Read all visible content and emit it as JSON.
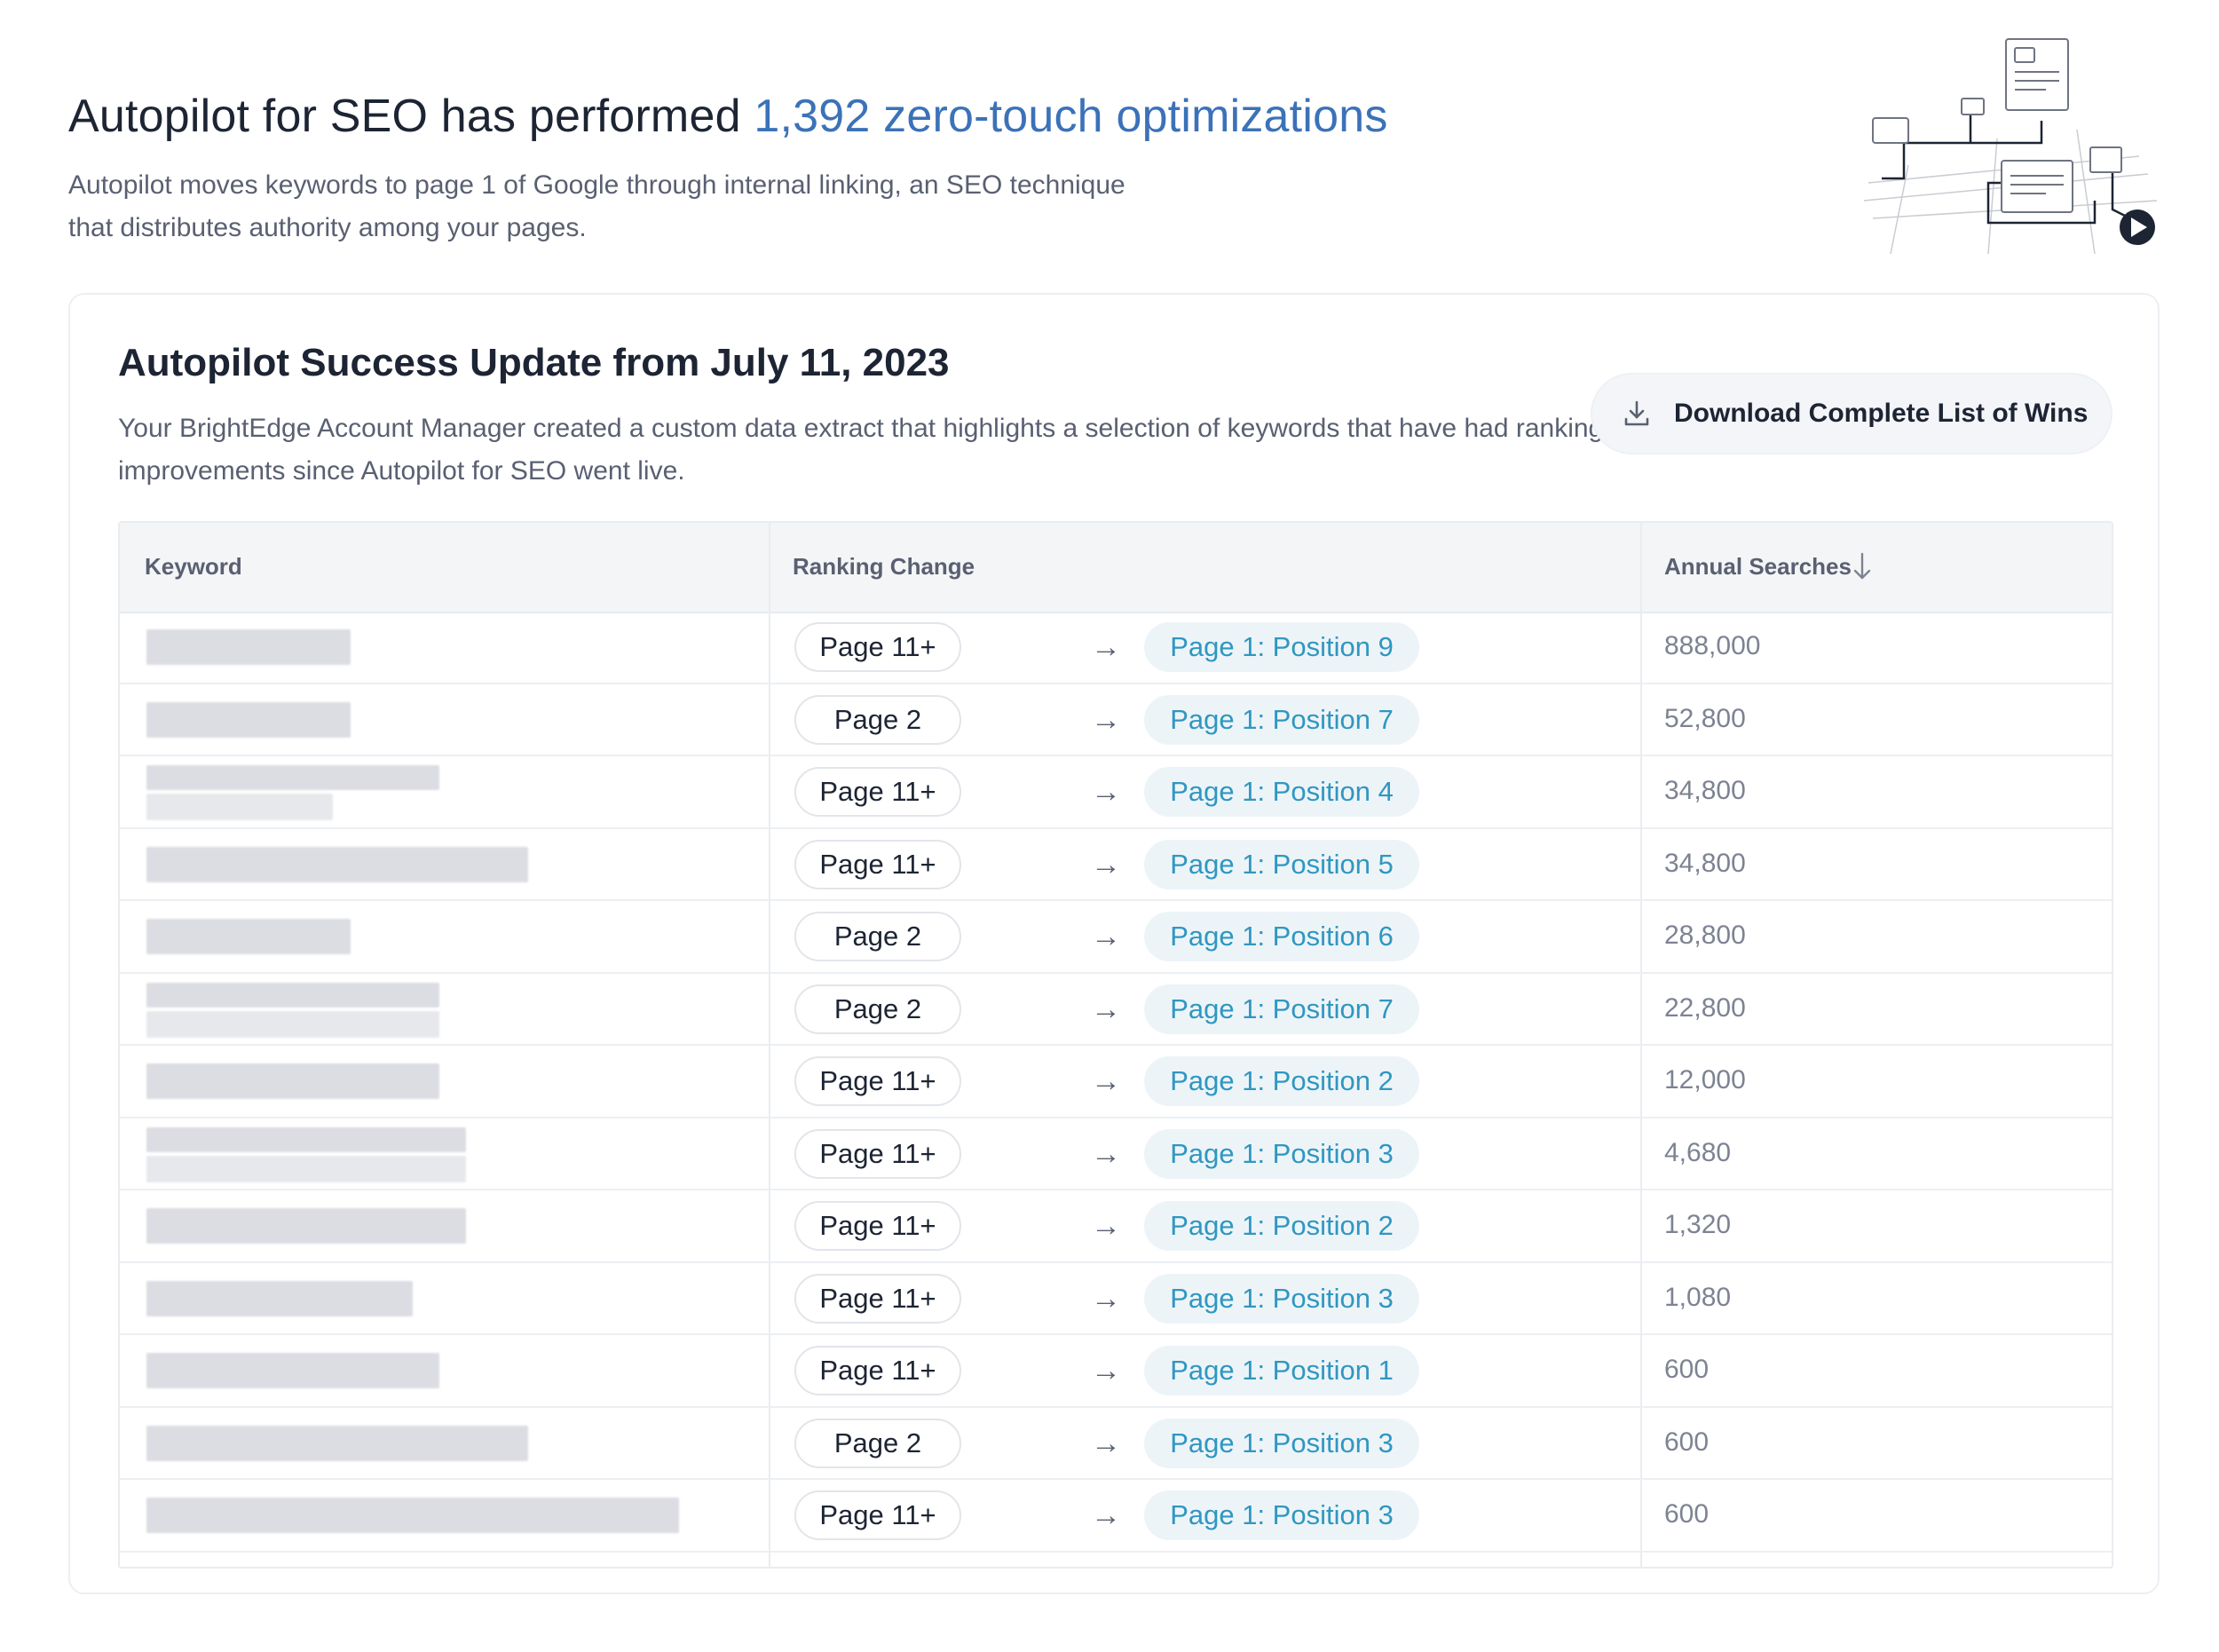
{
  "hero": {
    "title_prefix": "Autopilot for SEO has performed ",
    "title_highlight": "1,392 zero-touch optimizations",
    "subtitle": "Autopilot moves keywords to page 1 of Google through internal linking, an SEO technique that distributes authority among your pages."
  },
  "card": {
    "title": "Autopilot Success Update from July 11, 2023",
    "description": "Your BrightEdge Account Manager created a custom data extract that highlights a selection of keywords that have had ranking improvements since Autopilot for SEO went live.",
    "download_label": "Download Complete List of Wins"
  },
  "table": {
    "headers": {
      "keyword": "Keyword",
      "ranking_change": "Ranking Change",
      "annual_searches": "Annual Searches"
    },
    "rows": [
      {
        "from": "Page 11+",
        "to": "Page 1: Position 9",
        "searches": "888,000"
      },
      {
        "from": "Page 2",
        "to": "Page 1: Position 7",
        "searches": "52,800"
      },
      {
        "from": "Page 11+",
        "to": "Page 1: Position 4",
        "searches": "34,800"
      },
      {
        "from": "Page 11+",
        "to": "Page 1: Position 5",
        "searches": "34,800"
      },
      {
        "from": "Page 2",
        "to": "Page 1: Position 6",
        "searches": "28,800"
      },
      {
        "from": "Page 2",
        "to": "Page 1: Position 7",
        "searches": "22,800"
      },
      {
        "from": "Page 11+",
        "to": "Page 1: Position 2",
        "searches": "12,000"
      },
      {
        "from": "Page 11+",
        "to": "Page 1: Position 3",
        "searches": "4,680"
      },
      {
        "from": "Page 11+",
        "to": "Page 1: Position 2",
        "searches": "1,320"
      },
      {
        "from": "Page 11+",
        "to": "Page 1: Position 3",
        "searches": "1,080"
      },
      {
        "from": "Page 11+",
        "to": "Page 1: Position 1",
        "searches": "600"
      },
      {
        "from": "Page 2",
        "to": "Page 1: Position 3",
        "searches": "600"
      },
      {
        "from": "Page 11+",
        "to": "Page 1: Position 3",
        "searches": "600"
      }
    ]
  },
  "icons": {
    "download": "download-icon",
    "sort": "sort-desc-arrow-icon",
    "arrow": "right-arrow-icon",
    "illustration": "network-pages-illustration"
  },
  "colors": {
    "accent_title": "#3b72b8",
    "position_text": "#2f97c1",
    "position_bg": "#edf4f8"
  }
}
